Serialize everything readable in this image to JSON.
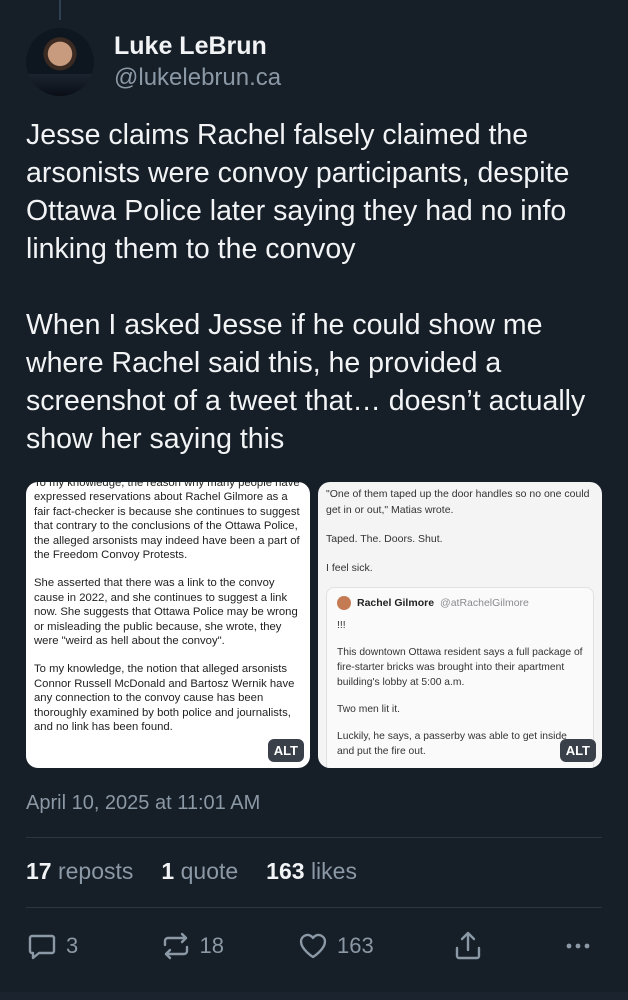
{
  "author": {
    "display_name": "Luke LeBrun",
    "handle": "@lukelebrun.ca"
  },
  "post": {
    "text": "Jesse claims Rachel falsely claimed the arsonists were convoy participants, despite Ottawa Police later saying they had no info linking them to the convoy\n\nWhen I asked Jesse if he could show me where Rachel said this, he provided a screenshot of a tweet that… doesn’t actually show her saying this"
  },
  "images": {
    "left": {
      "paragraphs": [
        "To my knowledge, the reason why many people have expressed reservations about Rachel Gilmore as a fair fact-checker is because she continues to suggest that contrary to the conclusions of the Ottawa Police, the alleged arsonists may indeed have been a part of the Freedom Convoy Protests.",
        "She asserted that there was a link to the convoy cause in 2022, and she continues to suggest a link now. She suggests that Ottawa Police may be wrong or misleading the public because, she wrote,  they were \"weird as hell about the convoy\".",
        "To my knowledge, the notion that alleged arsonists Connor Russell McDonald and Bartosz Wernik have any connection to the convoy cause has been thoroughly examined by both police and journalists, and no link has been found."
      ],
      "alt_label": "ALT"
    },
    "right": {
      "lines": [
        "\"One of them taped up the door handles so no one could get in or out,\" Matias wrote.",
        "Taped. The. Doors. Shut.",
        "I feel sick."
      ],
      "quote": {
        "name": "Rachel Gilmore",
        "handle": "@atRachelGilmore",
        "lines": [
          "!!!",
          "This downtown Ottawa resident says a full package of fire-starter bricks was brought into their apartment building's lobby at 5:00 a.m.",
          "Two men lit it.",
          "Luckily, he says, a passerby was able to get inside and put the fire out."
        ]
      },
      "alt_label": "ALT"
    }
  },
  "timestamp": "April 10, 2025 at 11:01 AM",
  "stats": {
    "reposts_count": "17",
    "reposts_label": "reposts",
    "quotes_count": "1",
    "quotes_label": "quote",
    "likes_count": "163",
    "likes_label": "likes"
  },
  "actions": {
    "reply_count": "3",
    "repost_count": "18",
    "like_count": "163"
  },
  "icons": {
    "reply": "speech-bubble-icon",
    "repost": "repost-arrows-icon",
    "like": "heart-icon",
    "share": "share-icon",
    "more": "ellipsis-icon"
  },
  "colors": {
    "background": "#161e27",
    "text": "#f1f3f5",
    "muted": "#8b98a5",
    "divider": "#2a3642"
  }
}
